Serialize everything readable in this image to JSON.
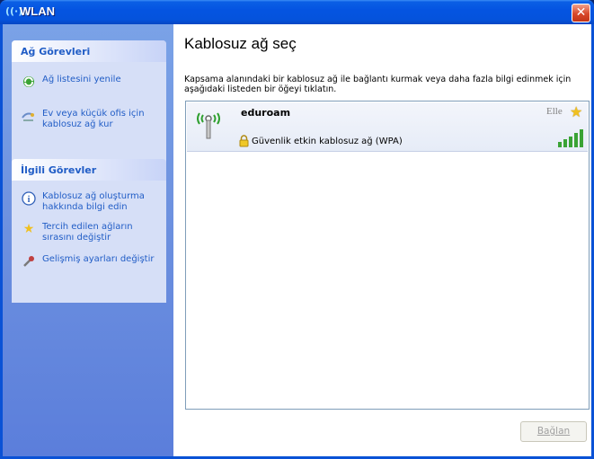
{
  "window": {
    "title": "WLAN"
  },
  "sidebar": {
    "network_tasks": {
      "header": "Ağ Görevleri",
      "items": [
        {
          "label": "Ağ listesini yenile",
          "icon": "refresh-icon"
        },
        {
          "label": "Ev veya küçük ofis için kablosuz ağ kur",
          "icon": "setup-network-icon"
        }
      ]
    },
    "related_tasks": {
      "header": "İlgili Görevler",
      "items": [
        {
          "label": "Kablosuz ağ oluşturma hakkında bilgi edin",
          "icon": "info-icon"
        },
        {
          "label": "Tercih edilen ağların sırasını değiştir",
          "icon": "star-icon"
        },
        {
          "label": "Gelişmiş ayarları değiştir",
          "icon": "settings-icon"
        }
      ]
    }
  },
  "main": {
    "heading": "Kablosuz ağ seç",
    "description": "Kapsama alanındaki bir kablosuz ağ ile bağlantı kurmak veya daha fazla bilgi edinmek için aşağıdaki listeden bir öğeyi tıklatın.",
    "networks": [
      {
        "name": "eduroam",
        "mode": "Elle",
        "security": "Güvenlik etkin kablosuz ağ (WPA)",
        "signal_bars": 5,
        "preferred": true
      }
    ],
    "connect_button": "Bağlan"
  },
  "colors": {
    "titlebar": "#0553dc",
    "sidebar": "#6f93e0",
    "task_link": "#215dc6",
    "panel_bg": "#d6dff7"
  }
}
